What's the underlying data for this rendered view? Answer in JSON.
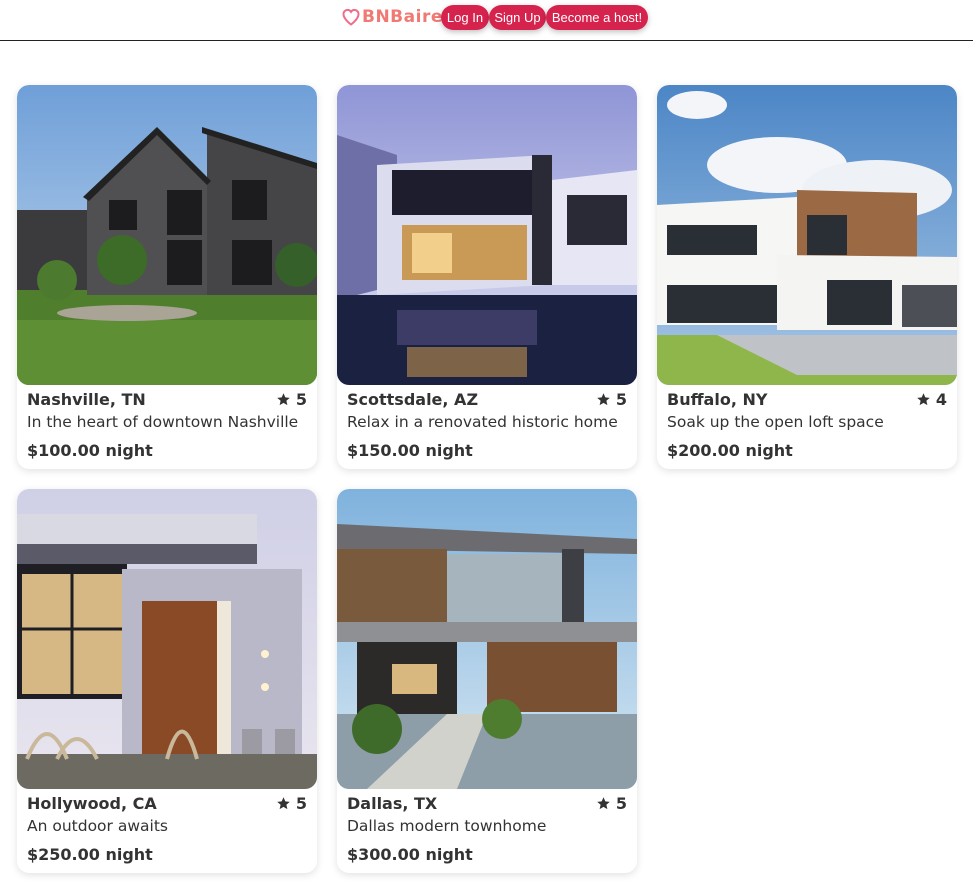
{
  "header": {
    "logo_text": "BNBaire",
    "login_label": "Log In",
    "signup_label": "Sign Up",
    "host_label": "Become a host!"
  },
  "colors": {
    "brand": "#d6234e",
    "logo": "#f07a73"
  },
  "listings": [
    {
      "location": "Nashville, TN",
      "rating": "5",
      "description": "In the heart of downtown Nashville",
      "price": "$100.00 night"
    },
    {
      "location": "Scottsdale, AZ",
      "rating": "5",
      "description": "Relax in a renovated historic home",
      "price": "$150.00 night"
    },
    {
      "location": "Buffalo, NY",
      "rating": "4",
      "description": "Soak up the open loft space",
      "price": "$200.00 night"
    },
    {
      "location": "Hollywood, CA",
      "rating": "5",
      "description": "An outdoor awaits",
      "price": "$250.00 night"
    },
    {
      "location": "Dallas, TX",
      "rating": "5",
      "description": "Dallas modern townhome",
      "price": "$300.00 night"
    }
  ]
}
